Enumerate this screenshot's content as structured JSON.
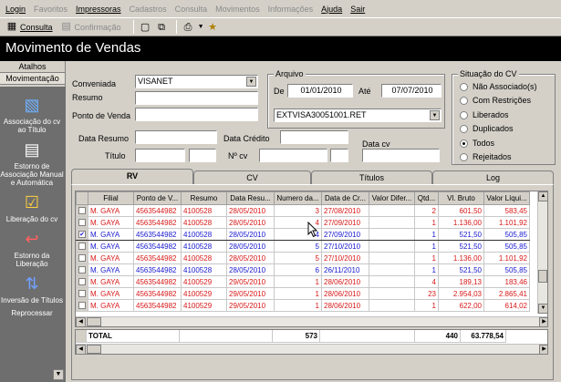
{
  "menu": [
    "Login",
    "Favoritos",
    "Impressoras",
    "Cadastros",
    "Consulta",
    "Movimentos",
    "Informações",
    "Ajuda",
    "Sair"
  ],
  "menu_disabled": [
    false,
    true,
    false,
    true,
    true,
    true,
    true,
    false,
    false
  ],
  "toolbar": {
    "consulta_label": "Consulta",
    "confirmacao_label": "Confirmação"
  },
  "window_title": "Movimento de Vendas",
  "sidebar": {
    "tabs": [
      "Atalhos",
      "Movimentação"
    ],
    "items": [
      {
        "label": "Associação do cv ao Título",
        "icon": "document-stack-icon"
      },
      {
        "label": "Estorno de Associação Manual e Automática",
        "icon": "document-undo-icon"
      },
      {
        "label": "Liberação do cv",
        "icon": "document-check-icon"
      },
      {
        "label": "Estorno da Liberação",
        "icon": "document-return-icon"
      },
      {
        "label": "Inversão de Títulos",
        "icon": "invert-icon"
      },
      {
        "label": "Reprocessar",
        "icon": "reprocess-icon"
      }
    ]
  },
  "form": {
    "conveniada_label": "Conveniada",
    "conveniada_value": "VISANET",
    "resumo_label": "Resumo",
    "ponto_venda_label": "Ponto de Venda",
    "data_resumo_label": "Data Resumo",
    "data_credito_label": "Data Crédito",
    "titulo_label": "Título",
    "ncv_label": "Nº cv",
    "data_cv_label": "Data cv",
    "arquivo_group": "Arquivo",
    "de_label": "De",
    "de_value": "01/01/2010",
    "ate_label": "Até",
    "ate_value": "07/07/2010",
    "arquivo_value": "EXTVISA30051001.RET"
  },
  "situacao": {
    "title": "Situação do CV",
    "options": [
      "Não Associado(s)",
      "Com Restrições",
      "Liberados",
      "Duplicados",
      "Todos",
      "Rejeitados"
    ],
    "selected": 4
  },
  "tabs": [
    "RV",
    "CV",
    "Títulos",
    "Log"
  ],
  "grid": {
    "columns": [
      "Filial",
      "Ponto de V...",
      "Resumo",
      "Data Resu...",
      "Numero da...",
      "Data de Cr...",
      "Valor Difer...",
      "Qtd...",
      "Vl. Bruto",
      "Valor Líqui..."
    ],
    "rows": [
      {
        "color": "red",
        "checked": false,
        "cells": [
          "M. GAYA",
          "4563544982",
          "4100528",
          "28/05/2010",
          "3",
          "27/08/2010",
          "",
          "2",
          "601,50",
          "583,45"
        ]
      },
      {
        "color": "red",
        "checked": false,
        "cells": [
          "M. GAYA",
          "4563544982",
          "4100528",
          "28/05/2010",
          "4",
          "27/09/2010",
          "",
          "1",
          "1.136,00",
          "1.101,92"
        ]
      },
      {
        "color": "sel",
        "checked": true,
        "cells": [
          "M. GAYA",
          "4563544982",
          "4100528",
          "28/05/2010",
          "4",
          "27/09/2010",
          "",
          "1",
          "521,50",
          "505,85"
        ]
      },
      {
        "color": "blue",
        "checked": false,
        "cells": [
          "M. GAYA",
          "4563544982",
          "4100528",
          "28/05/2010",
          "5",
          "27/10/2010",
          "",
          "1",
          "521,50",
          "505,85"
        ]
      },
      {
        "color": "red",
        "checked": false,
        "cells": [
          "M. GAYA",
          "4563544982",
          "4100528",
          "28/05/2010",
          "5",
          "27/10/2010",
          "",
          "1",
          "1.136,00",
          "1.101,92"
        ]
      },
      {
        "color": "blue",
        "checked": false,
        "cells": [
          "M. GAYA",
          "4563544982",
          "4100528",
          "28/05/2010",
          "6",
          "26/11/2010",
          "",
          "1",
          "521,50",
          "505,85"
        ]
      },
      {
        "color": "red",
        "checked": false,
        "cells": [
          "M. GAYA",
          "4563544982",
          "4100529",
          "29/05/2010",
          "1",
          "28/06/2010",
          "",
          "4",
          "189,13",
          "183,46"
        ]
      },
      {
        "color": "red",
        "checked": false,
        "cells": [
          "M. GAYA",
          "4563544982",
          "4100529",
          "29/05/2010",
          "1",
          "28/06/2010",
          "",
          "23",
          "2.954,03",
          "2.865,41"
        ]
      },
      {
        "color": "red",
        "checked": false,
        "cells": [
          "M. GAYA",
          "4563544982",
          "4100529",
          "29/05/2010",
          "1",
          "28/06/2010",
          "",
          "1",
          "622,00",
          "614,02"
        ]
      }
    ]
  },
  "totals": {
    "label": "TOTAL",
    "numero": "573",
    "qtd": "440",
    "vl_bruto": "63.778,54"
  }
}
